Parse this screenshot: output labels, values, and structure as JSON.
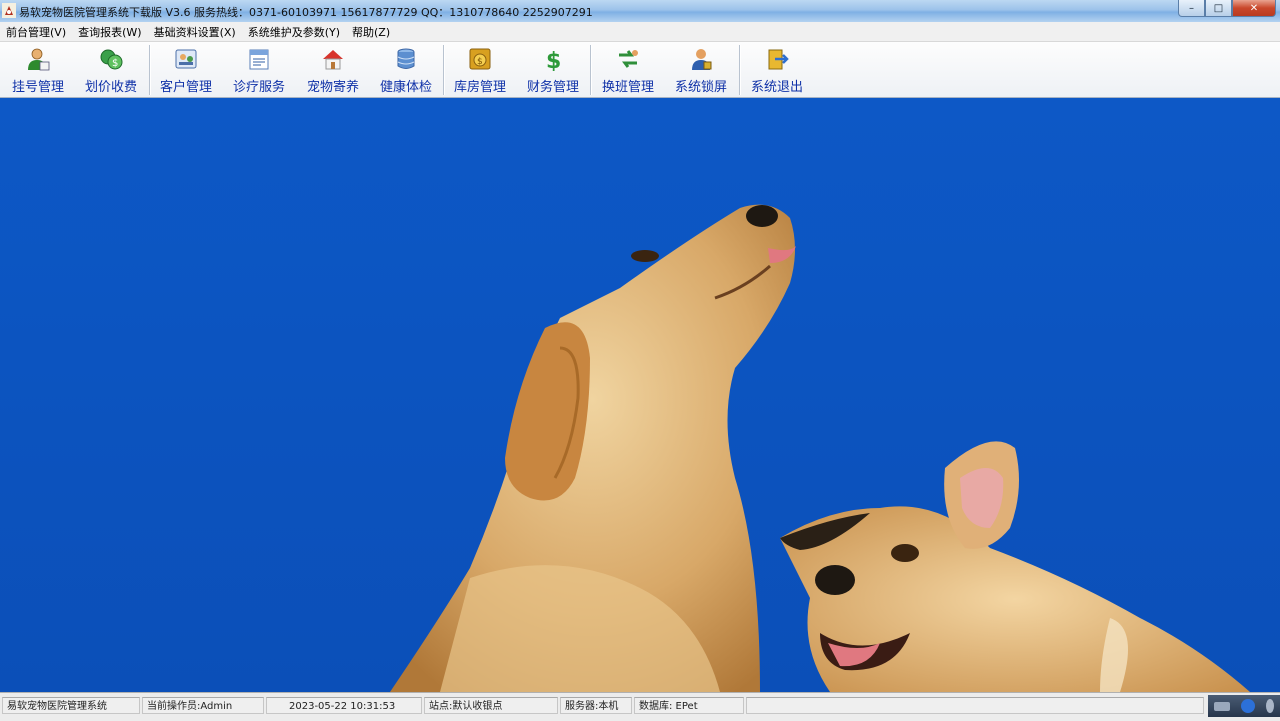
{
  "window": {
    "title": "易软宠物医院管理系统下载版 V3.6  服务热线：0371-60103971 15617877729  QQ：1310778640 2252907291",
    "buttons": {
      "minimize": "–",
      "maximize": "□",
      "close": "✕"
    }
  },
  "menu": [
    "前台管理(V)",
    "查询报表(W)",
    "基础资料设置(X)",
    "系统维护及参数(Y)",
    "帮助(Z)"
  ],
  "toolbar": [
    {
      "label": "挂号管理",
      "icon": "user-register-icon"
    },
    {
      "label": "划价收费",
      "icon": "money-exchange-icon"
    },
    {
      "label": "客户管理",
      "icon": "customers-icon"
    },
    {
      "label": "诊疗服务",
      "icon": "diagnosis-form-icon"
    },
    {
      "label": "宠物寄养",
      "icon": "pet-house-icon"
    },
    {
      "label": "健康体检",
      "icon": "database-icon"
    },
    {
      "label": "库房管理",
      "icon": "money-bag-icon"
    },
    {
      "label": "财务管理",
      "icon": "dollar-icon"
    },
    {
      "label": "换班管理",
      "icon": "shift-handover-icon"
    },
    {
      "label": "系统锁屏",
      "icon": "lock-screen-user-icon"
    },
    {
      "label": "系统退出",
      "icon": "exit-door-icon"
    }
  ],
  "status": {
    "app_name": "易软宠物医院管理系统",
    "operator": "当前操作员:Admin",
    "datetime": "2023-05-22  10:31:53",
    "station": "站点:默认收银点",
    "server": "服务器:本机",
    "database": "数据库: EPet"
  },
  "colors": {
    "sky": "#0a58c8",
    "toolbar_text": "#1032a8",
    "dog_fur": "#d8a868"
  }
}
